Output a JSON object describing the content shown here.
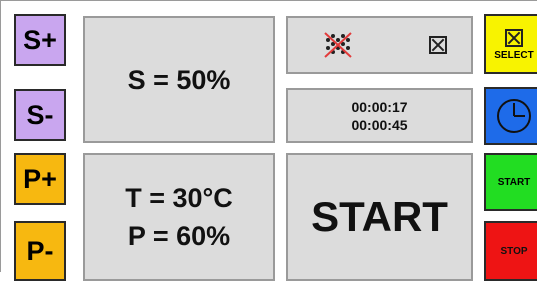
{
  "left_buttons": {
    "s_plus": "S+",
    "s_minus": "S-",
    "p_plus": "P+",
    "p_minus": "P-"
  },
  "displays": {
    "speed": "S = 50%",
    "temperature": "T = 30°C",
    "pressure": "P = 60%",
    "elapsed_time": "00:00:17",
    "total_time": "00:00:45"
  },
  "center": {
    "start_label": "START"
  },
  "right_buttons": {
    "select_label": "SELECT",
    "start_label": "START",
    "stop_label": "STOP"
  },
  "icons": {
    "no_spray": "no-spray-icon",
    "checkbox": "checkbox-x-icon",
    "clock": "clock-icon"
  },
  "colors": {
    "purple_button": "#c9a6ef",
    "orange_button": "#f7b810",
    "select_button": "#f8f300",
    "clock_button": "#1e6be9",
    "start_button": "#22dd22",
    "stop_button": "#ee1414",
    "display_background": "#dcdcdc"
  }
}
